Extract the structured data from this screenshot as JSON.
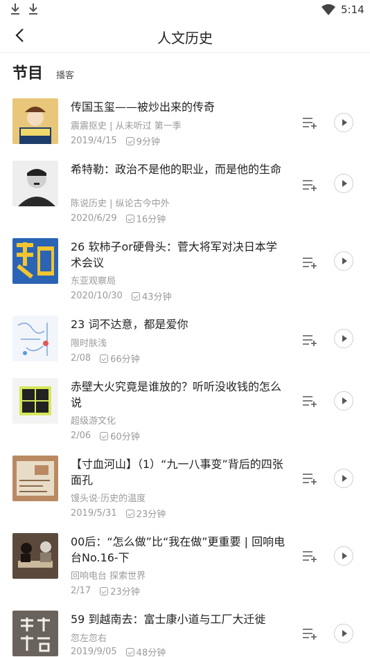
{
  "status_bar": {
    "time": "5:14",
    "icons": [
      "download-icon",
      "download-icon",
      "wifi-icon"
    ]
  },
  "header": {
    "title": "人文历史",
    "back_icon": "chevron-left-icon"
  },
  "section": {
    "title": "节目",
    "tag": "播客"
  },
  "items": [
    {
      "title": "传国玉玺——被炒出来的传奇",
      "source": "震震抠史 | 从未听过 第一季",
      "date": "2019/4/15",
      "duration": "9分钟",
      "thumb_color": "#e8c77a"
    },
    {
      "title": "希特勒：政治不是他的职业，而是他的生命",
      "source": "陈说历史 | 纵论古今中外",
      "date": "2020/6/29",
      "duration": "16分钟",
      "thumb_color": "#3a3a3a"
    },
    {
      "title": "26 软柿子or硬骨头：菅大将军对决日本学术会议",
      "source": "东亚观察局",
      "date": "2020/10/30",
      "duration": "43分钟",
      "thumb_color": "#2b64b4"
    },
    {
      "title": "23 词不达意，都是爱你",
      "source": "限时肤浅",
      "date": "2/08",
      "duration": "66分钟",
      "thumb_color": "#f2f5fa"
    },
    {
      "title": "赤壁大火究竟是谁放的？听听没收钱的怎么说",
      "source": "超级游文化",
      "date": "2/06",
      "duration": "60分钟",
      "thumb_color": "#f3f3f3"
    },
    {
      "title": "【寸血河山】（1）“九一八事变”背后的四张面孔",
      "source": "馒头说·历史的温度",
      "date": "2019/5/31",
      "duration": "23分钟",
      "thumb_color": "#b98a62"
    },
    {
      "title": "00后：“怎么做”比“我在做”更重要 | 回响电台No.16-下",
      "source": "回响电台 探索世界",
      "date": "2/17",
      "duration": "23分钟",
      "thumb_color": "#5b4a3c"
    },
    {
      "title": "59 到越南去：富士康小道与工厂大迁徙",
      "source": "忽左忽右",
      "date": "2019/9/05",
      "duration": "48分钟",
      "thumb_color": "#6a625c"
    }
  ]
}
